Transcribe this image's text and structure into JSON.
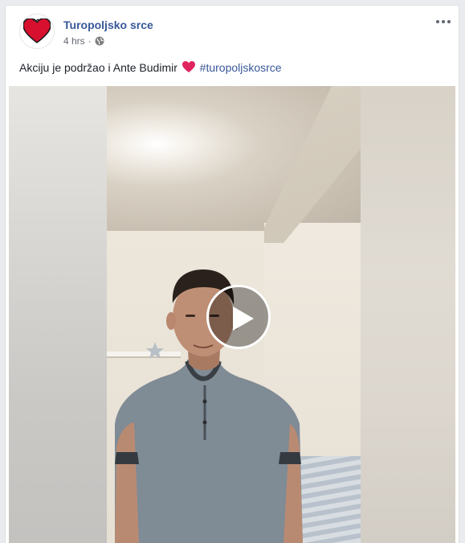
{
  "post": {
    "page_name": "Turopoljsko srce",
    "time": "4 hrs",
    "separator": "·",
    "privacy_icon": "globe-icon",
    "more_icon": "ellipsis-icon",
    "text_before": "Akciju je podržao i Ante Budimir",
    "emoji": "red-heart",
    "hashtag": "#turopoljskosrce"
  },
  "video": {
    "play_icon": "play-icon"
  },
  "colors": {
    "link": "#385898",
    "text": "#1d2129",
    "meta": "#616770",
    "heart": "#e0245e"
  }
}
